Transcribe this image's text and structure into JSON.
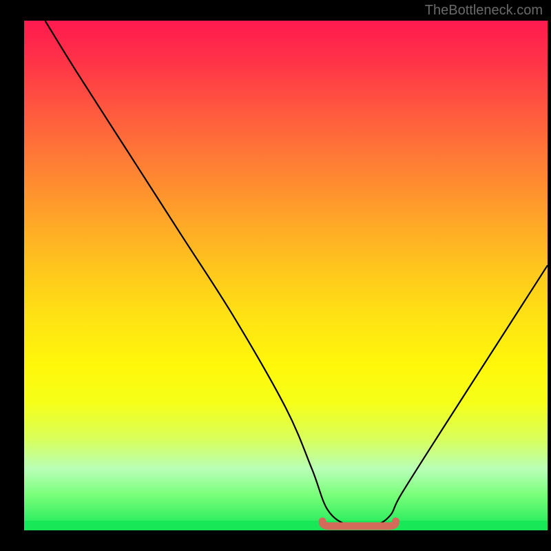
{
  "watermark": "TheBottleneck.com",
  "chart_data": {
    "type": "line",
    "title": "",
    "xlabel": "",
    "ylabel": "",
    "xlim": [
      0,
      100
    ],
    "ylim": [
      0,
      100
    ],
    "series": [
      {
        "name": "bottleneck-curve",
        "x": [
          4,
          10,
          20,
          30,
          40,
          50,
          55,
          58,
          62,
          67,
          70,
          72,
          80,
          90,
          100
        ],
        "y": [
          100,
          90,
          74,
          58,
          42,
          24,
          12,
          4,
          1,
          1,
          3,
          7,
          20,
          36,
          52
        ]
      }
    ],
    "highlight_segment": {
      "name": "optimal-range",
      "x_start": 57,
      "x_end": 71,
      "y": 1.5,
      "color": "#d46a5a"
    },
    "gradient_stops": [
      {
        "pos": 0,
        "color": "#ff1a4f"
      },
      {
        "pos": 50,
        "color": "#ffd21e"
      },
      {
        "pos": 100,
        "color": "#18e858"
      }
    ]
  }
}
